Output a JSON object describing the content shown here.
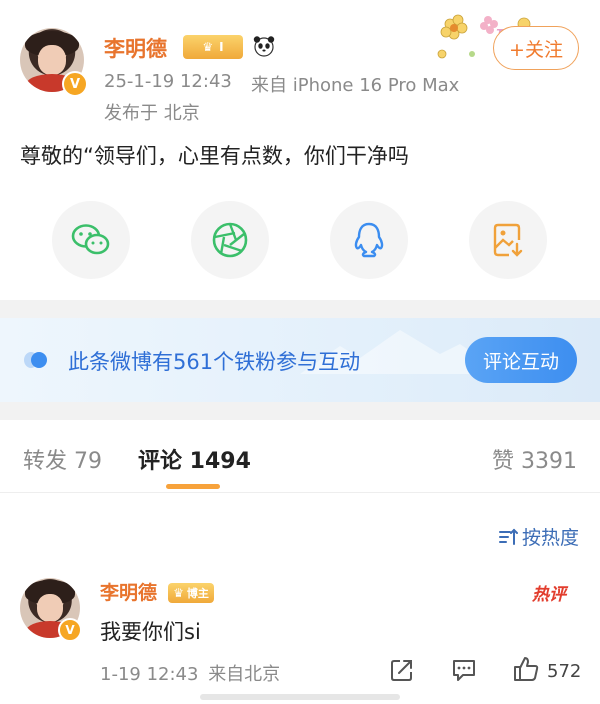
{
  "post": {
    "author": "李明德",
    "rank_badge": "I",
    "timestamp": "25-1-19 12:43",
    "source": "来自 iPhone 16 Pro Max",
    "location": "发布于 北京",
    "follow_label": "+关注",
    "text": "尊敬的“领导们，心里有点数，你们干净吗"
  },
  "share": {
    "items": [
      "wechat-icon",
      "moments-icon",
      "qq-icon",
      "save-image-icon"
    ],
    "colors": {
      "wechat": "#3bbf6a",
      "moments": "#3bbf6a",
      "qq": "#3b8df0",
      "save": "#f0a13a"
    }
  },
  "fans_banner": {
    "text": "此条微博有561个铁粉参与互动",
    "button": "评论互动"
  },
  "tabs": {
    "repost": "转发 79",
    "comments": "评论 1494",
    "likes": "赞 3391"
  },
  "sort_label": "按热度",
  "comment": {
    "author": "李明德",
    "role_badge": "博主",
    "hot_tag": "热评",
    "text": "我要你们si",
    "time": "1-19 12:43",
    "source": "来自北京",
    "like_count": "572"
  },
  "colors": {
    "accent_orange": "#e8742d",
    "link_blue": "#2f6fd6",
    "tab_underline": "#f7a23b"
  }
}
